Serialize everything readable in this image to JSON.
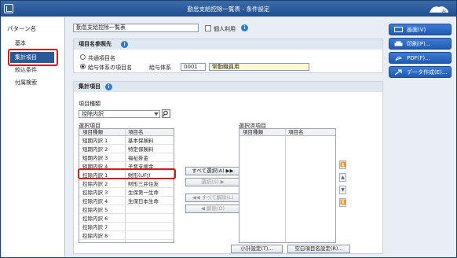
{
  "window": {
    "title": "勤怠支給控除一覧表 - 条件設定"
  },
  "sidebar": {
    "header": "パターン名",
    "items": [
      {
        "label": "基本"
      },
      {
        "label": "集計項目"
      },
      {
        "label": "絞込条件"
      },
      {
        "label": "付属検索"
      }
    ]
  },
  "pattern": {
    "name_value": "勤怠支給控除一覧表",
    "personal_label": "個人利用"
  },
  "ref_section": {
    "title": "項目名参照先",
    "common_label": "共通項目名",
    "system_label": "給与体系の項目名",
    "system_name_label": "給与体系",
    "system_code": "0001",
    "system_name": "常勤職員用"
  },
  "agg_section": {
    "title": "集計項目",
    "kind_label": "項目種類",
    "kind_value": "控除内訳",
    "select_label": "選択項目",
    "selected_label": "選択済項目",
    "col_kind": "項目種類",
    "col_name": "項目名",
    "rows": [
      {
        "kind": "短期内訳 1",
        "name": "基本保険料"
      },
      {
        "kind": "短期内訳 2",
        "name": "特定保険料"
      },
      {
        "kind": "短期内訳 3",
        "name": "福祉掛金"
      },
      {
        "kind": "短期内訳 4",
        "name": "子育支援金"
      },
      {
        "kind": "控除内訳 1",
        "name": "財形(UFJ)"
      },
      {
        "kind": "控除内訳 2",
        "name": "財形三井住友"
      },
      {
        "kind": "控除内訳 3",
        "name": "生保第一生命"
      },
      {
        "kind": "控除内訳 4",
        "name": "生保日本生命"
      },
      {
        "kind": "控除内訳 5",
        "name": ""
      },
      {
        "kind": "控除内訳 6",
        "name": ""
      },
      {
        "kind": "控除内訳 7",
        "name": ""
      },
      {
        "kind": "控除内訳 8",
        "name": ""
      }
    ],
    "btn_select_all": "すべて選択(A)",
    "btn_select": "選択(S)",
    "btn_release_all": "すべて解除(L)",
    "btn_release": "解除(D)",
    "btn_subtotal": "小計設定(T)...",
    "btn_blank": "空白項目名設定(R)..."
  },
  "right_panel": {
    "screen": "画面(V)",
    "print": "印刷(P)...",
    "pdf": "PDF(F)...",
    "data": "データ作成(E)..."
  }
}
